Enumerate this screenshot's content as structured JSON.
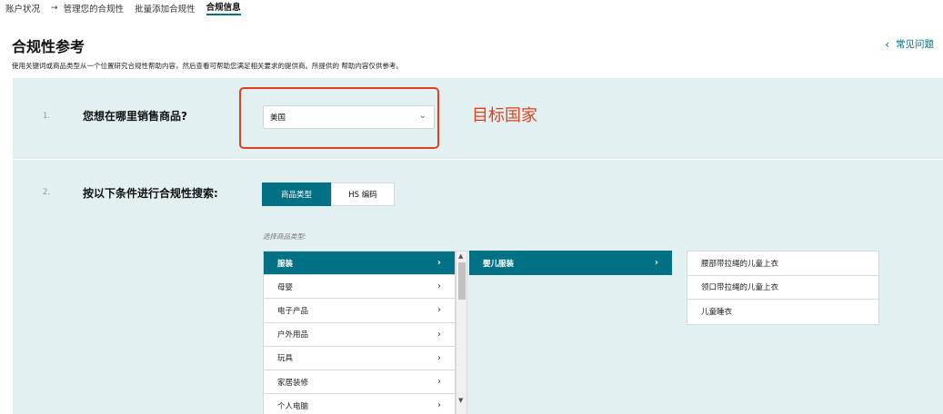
{
  "breadcrumb": {
    "items": [
      "账户状况",
      "管理您的合规性",
      "批量添加合规性",
      "合规信息"
    ],
    "separator": "→"
  },
  "page": {
    "title": "合规性参考",
    "subtitle": "使用关键词或商品类型从一个位置研究合规性帮助内容，然后查看可帮助您满足相关要求的提供商。所提供的 帮助内容仅供参考。",
    "faq": "常见问题",
    "faq_icon": "chevron-left"
  },
  "step1": {
    "num": "1.",
    "label": "您想在哪里销售商品?",
    "country_value": "美国",
    "annotation": "目标国家"
  },
  "step2": {
    "num": "2.",
    "label": "按以下条件进行合规性搜索:",
    "tabs": [
      "商品类型",
      "HS 编码"
    ],
    "active_tab": 0,
    "choose_label": "选择商品类型:",
    "categories": [
      "服装",
      "母婴",
      "电子产品",
      "户外用品",
      "玩具",
      "家居装修",
      "个人电脑"
    ],
    "selected_category": 0,
    "subcategories": [
      "婴儿服装"
    ],
    "items": [
      "腰部带拉绳的儿童上衣",
      "领口带拉绳的儿童上衣",
      "儿童睡衣"
    ]
  },
  "colors": {
    "accent": "#007185",
    "panel_bg": "#e3f0f2",
    "annotation": "#e2401c"
  }
}
